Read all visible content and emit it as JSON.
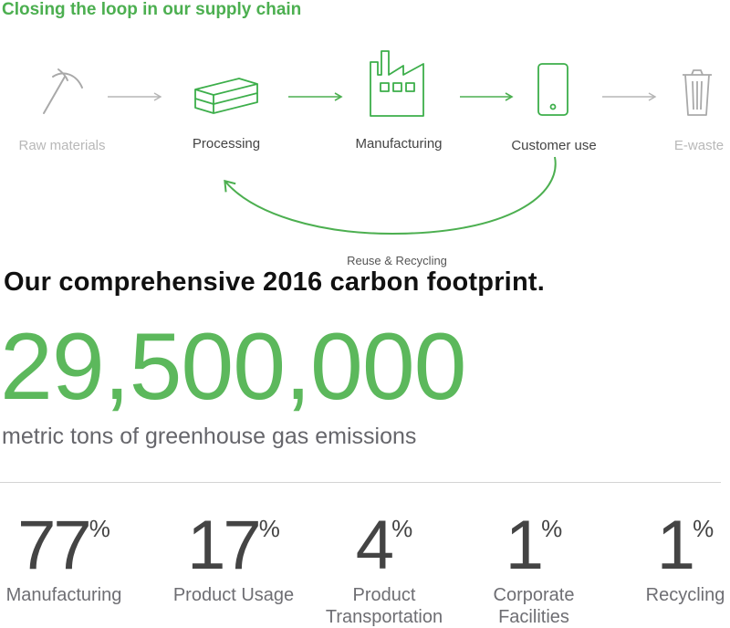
{
  "loop": {
    "title": "Closing the loop in our supply chain",
    "stages": [
      {
        "label": "Raw materials",
        "icon": "pickaxe-icon",
        "active": false
      },
      {
        "label": "Processing",
        "icon": "ingots-icon",
        "active": true
      },
      {
        "label": "Manufacturing",
        "icon": "factory-icon",
        "active": true
      },
      {
        "label": "Customer use",
        "icon": "phone-icon",
        "active": true
      },
      {
        "label": "E-waste",
        "icon": "trash-can-icon",
        "active": false
      }
    ],
    "return_label": "Reuse & Recycling"
  },
  "footprint": {
    "heading": "Our comprehensive 2016 carbon footprint.",
    "total": "29,500,000",
    "total_caption": "metric tons of greenhouse gas emissions"
  },
  "breakdown": [
    {
      "value": "77",
      "unit": "%",
      "label": "Manufacturing"
    },
    {
      "value": "17",
      "unit": "%",
      "label": "Product Usage"
    },
    {
      "value": "4",
      "unit": "%",
      "label": "Product Transportation"
    },
    {
      "value": "1",
      "unit": "%",
      "label": "Corporate Facilities"
    },
    {
      "value": "1",
      "unit": "%",
      "label": "Recycling"
    }
  ],
  "colors": {
    "accent_green": "#4caf50",
    "number_green": "#5cb85c",
    "muted_gray": "#b8b8b8",
    "text_dark": "#444444"
  }
}
